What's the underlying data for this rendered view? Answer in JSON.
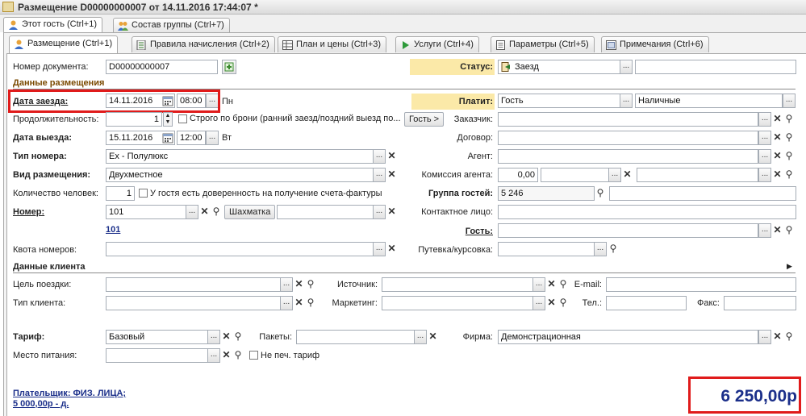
{
  "window": {
    "title": "Размещение D00000000007 от 14.11.2016 17:44:07 *"
  },
  "outer_tabs": [
    {
      "label": "Этот гость (Ctrl+1)"
    },
    {
      "label": "Состав группы (Ctrl+7)"
    }
  ],
  "inner_tabs": [
    {
      "label": "Размещение (Ctrl+1)"
    },
    {
      "label": "Правила начисления (Ctrl+2)"
    },
    {
      "label": "План и цены (Ctrl+3)"
    },
    {
      "label": "Услуги (Ctrl+4)"
    },
    {
      "label": "Параметры (Ctrl+5)"
    },
    {
      "label": "Примечания (Ctrl+6)"
    }
  ],
  "form": {
    "doc_number_label": "Номер документа:",
    "doc_number_value": "D00000000007",
    "status_label": "Статус:",
    "status_value": "Заезд",
    "placement_section": "Данные размещения",
    "checkin_label": "Дата заезда:",
    "checkin_date": "14.11.2016",
    "checkin_time": "08:00",
    "checkin_day": "Пн",
    "pays_label": "Платит:",
    "pays_value": "Гость",
    "payment_method": "Наличные",
    "duration_label": "Продолжительность:",
    "duration_value": "1",
    "strict_label": "Строго по брони (ранний заезд/поздний выезд по...",
    "guest_button": "Гость >",
    "customer_label": "Заказчик:",
    "checkout_label": "Дата выезда:",
    "checkout_date": "15.11.2016",
    "checkout_time": "12:00",
    "checkout_day": "Вт",
    "contract_label": "Договор:",
    "room_type_label": "Тип номера:",
    "room_type_value": "Ex - Полулюкс",
    "agent_label": "Агент:",
    "accommodation_label": "Вид размещения:",
    "accommodation_value": "Двухместное",
    "agent_commission_label": "Комиссия агента:",
    "agent_commission_value": "0,00",
    "persons_label": "Количество человек:",
    "persons_value": "1",
    "invoice_trust_label": "У гостя есть доверенность на получение счета-фактуры",
    "guest_group_label": "Группа гостей:",
    "guest_group_value": "5 246",
    "room_label": "Номер:",
    "room_value": "101",
    "chess_button": "Шахматка",
    "contact_label": "Контактное лицо:",
    "room_link": "101",
    "guest_label": "Гость:",
    "quota_label": "Квота номеров:",
    "voucher_label": "Путевка/курсовка:",
    "client_section": "Данные клиента",
    "trip_purpose_label": "Цель поездки:",
    "source_label": "Источник:",
    "email_label": "E-mail:",
    "client_type_label": "Тип клиента:",
    "marketing_label": "Маркетинг:",
    "phone_label": "Тел.:",
    "fax_label": "Факс:",
    "tariff_label": "Тариф:",
    "tariff_value": "Базовый",
    "packages_label": "Пакеты:",
    "firm_label": "Фирма:",
    "firm_value": "Демонстрационная",
    "meal_label": "Место питания:",
    "no_print_tariff_label": "Не печ. тариф",
    "payer_link": "Плательщик: ФИЗ. ЛИЦА;",
    "payer_amount": "5 000,00р - д.",
    "total": "6 250,00р"
  },
  "colors": {
    "highlight_red": "#e01b1b",
    "pays_highlight": "#fbe9a8",
    "link_blue": "#1b2f8a",
    "section_brown": "#7a4a00",
    "total_blue": "#1b2f8a"
  }
}
